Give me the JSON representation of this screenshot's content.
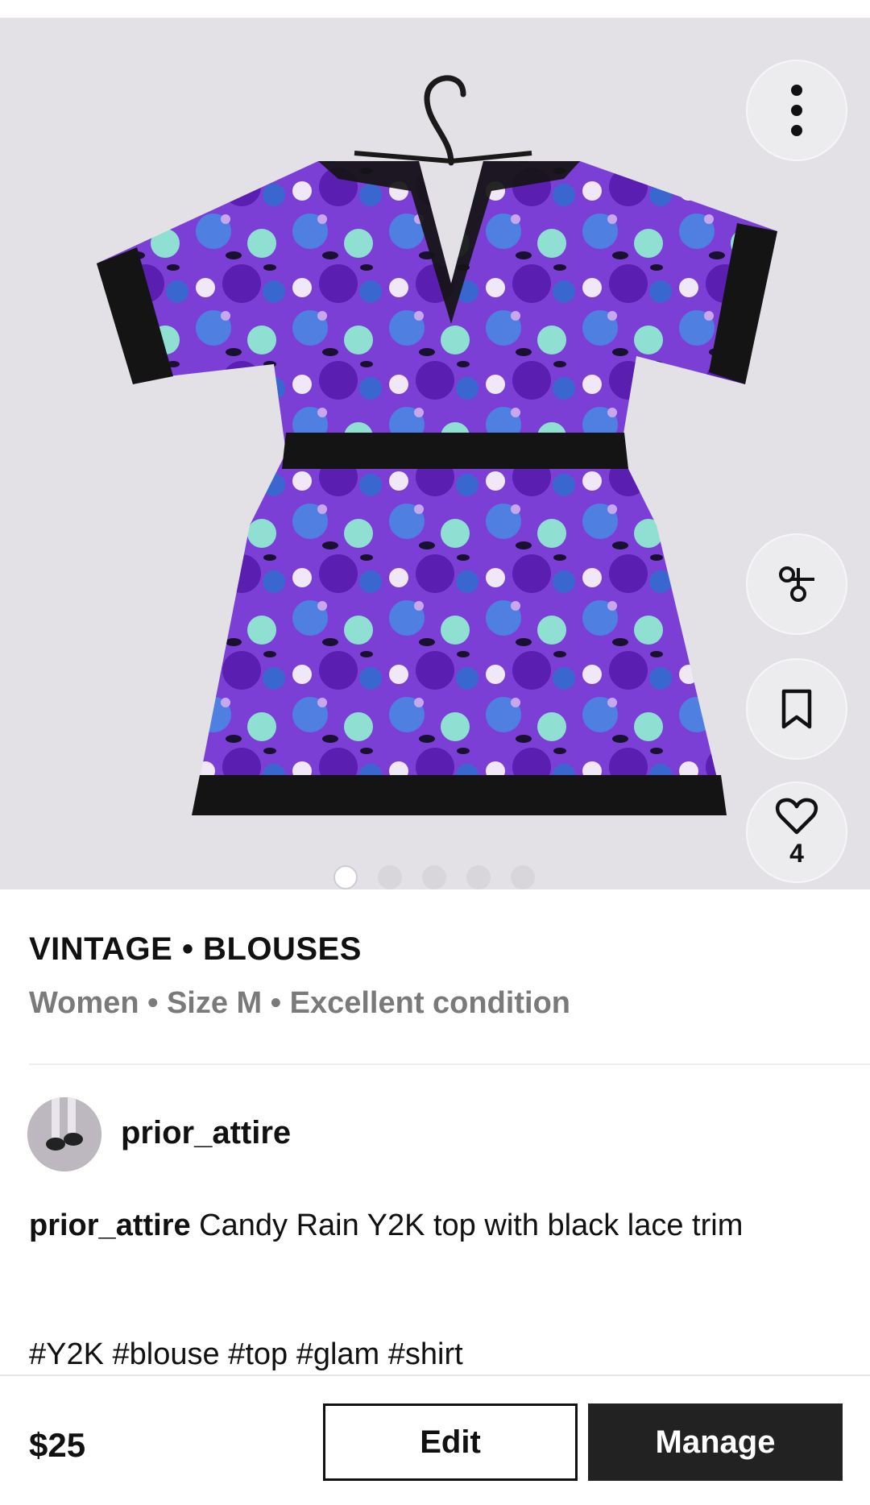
{
  "listing": {
    "category": "VINTAGE • BLOUSES",
    "meta": "Women • Size M • Excellent condition",
    "likes": "4",
    "photo_count": 5,
    "active_photo_index": 0
  },
  "seller": {
    "username": "prior_attire"
  },
  "description": {
    "user": "prior_attire",
    "text": " Candy Rain Y2K top with black lace trim",
    "tags": "#Y2K #blouse #top #glam #shirt"
  },
  "bottom_bar": {
    "price": "$25",
    "edit_label": "Edit",
    "manage_label": "Manage"
  },
  "icons": {
    "more": "more-vertical-icon",
    "scissors": "scissors-icon",
    "bookmark": "bookmark-icon",
    "like": "heart-icon"
  },
  "colors": {
    "photo_bg": "#e4e1e6",
    "accent_purple": "#6a2fc4",
    "manage_bg": "#222222"
  }
}
